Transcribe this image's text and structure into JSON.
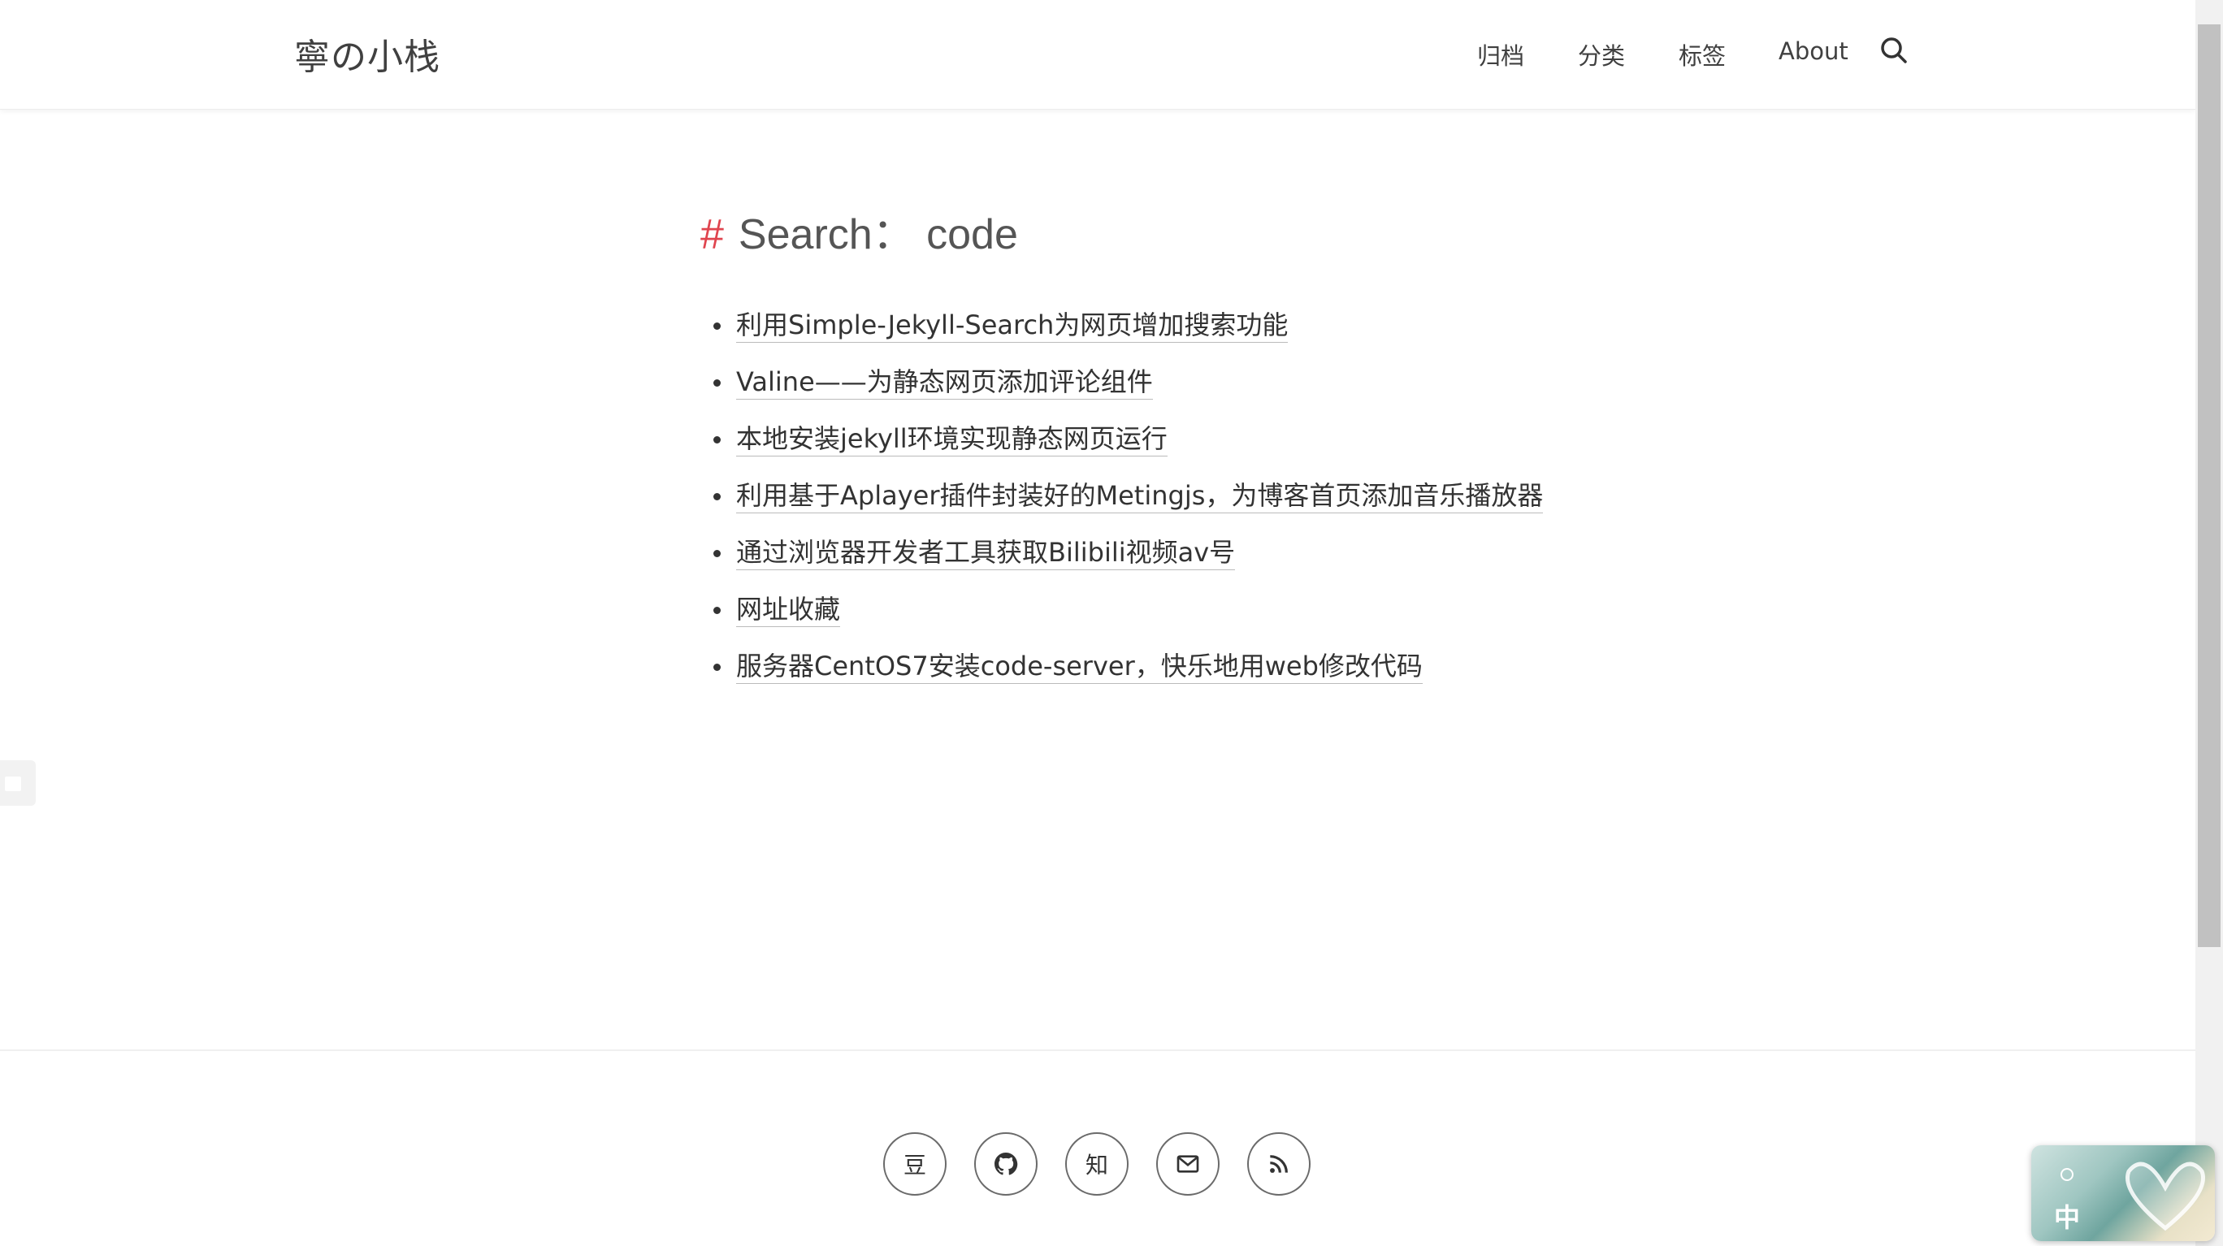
{
  "header": {
    "logo": "寧の小栈",
    "nav": [
      {
        "label": "归档",
        "name": "nav-archive"
      },
      {
        "label": "分类",
        "name": "nav-categories"
      },
      {
        "label": "标签",
        "name": "nav-tags"
      },
      {
        "label": "About",
        "name": "nav-about"
      }
    ],
    "search_icon": "search-icon"
  },
  "main": {
    "hash": "#",
    "title": "Search： code",
    "results": [
      "利用Simple-Jekyll-Search为网页增加搜索功能",
      "Valine——为静态网页添加评论组件",
      "本地安装jekyll环境实现静态网页运行",
      "利用基于Aplayer插件封装好的Metingjs，为博客首页添加音乐播放器",
      "通过浏览器开发者工具获取Bilibili视频av号",
      "网址收藏",
      "服务器CentOS7安装code-server，快乐地用web修改代码"
    ]
  },
  "footer": {
    "social": [
      {
        "label": "豆",
        "name": "douban-icon"
      },
      {
        "label": "",
        "name": "github-icon"
      },
      {
        "label": "知",
        "name": "zhihu-icon"
      },
      {
        "label": "",
        "name": "mail-icon"
      },
      {
        "label": "",
        "name": "rss-icon"
      }
    ]
  },
  "ime": {
    "label": "中"
  },
  "colors": {
    "accent": "#e0454f",
    "text": "#333333"
  }
}
